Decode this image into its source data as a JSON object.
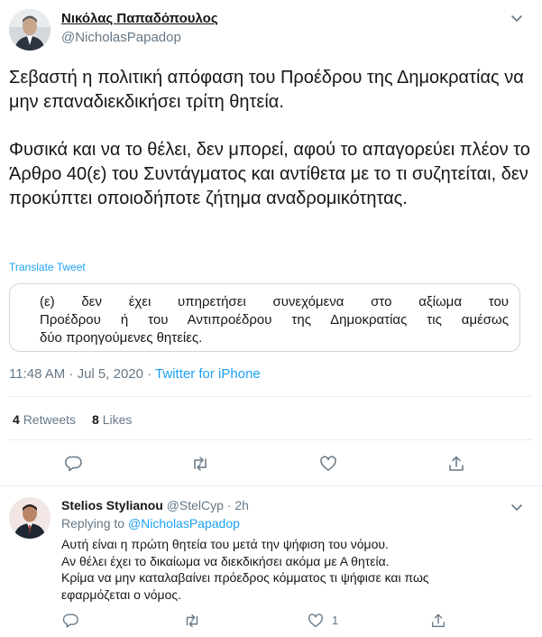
{
  "tweet": {
    "author_name": "Νικόλας Παπαδόπουλος",
    "author_handle": "@NicholasPapadop",
    "paragraph1": "Σεβαστή η πολιτική απόφαση του Προέδρου της Δημοκρατίας να μην επαναδιεκδικήσει τρίτη θητεία.",
    "paragraph2": "Φυσικά και να το θέλει, δεν μπορεί, αφού το απαγορεύει πλέον το Άρθρο 40(ε) του Συντάγματος και αντίθετα με το τι συζητείται, δεν προκύπτει οποιοδήποτε ζήτημα αναδρομικότητας.",
    "translate_label": "Translate Tweet",
    "quote_lines": [
      "(ε) δεν έχει υπηρετήσει συνεχόμενα στο αξίωμα του",
      "Προέδρου ή του Αντιπροέδρου της Δημοκρατίας τις αμέσως",
      "δύο προηγούμενες θητείες."
    ],
    "timestamp": "11:48 AM · Jul 5, 2020 · ",
    "source": "Twitter for iPhone",
    "retweets_count": "4",
    "retweets_label": "Retweets",
    "likes_count": "8",
    "likes_label": "Likes"
  },
  "reply": {
    "author_name": "Stelios Stylianou",
    "author_handle": "@StelCyp",
    "time": " · 2h",
    "replying_prefix": "Replying to ",
    "replying_to": "@NicholasPapadop",
    "lines": [
      "Αυτή είναι η πρώτη θητεία του μετά την ψήφιση του νόμου.",
      "Αν θέλει έχει το δικαίωμα να διεκδικήσει ακόμα με Α θητεία.",
      "Κρίμα να μην καταλαβαίνει πρόεδρος κόμματος τι ψήφισε και πως",
      "εφαρμόζεται ο νόμος."
    ],
    "like_count": "1"
  },
  "icons": {
    "reply": "comment-icon",
    "retweet": "retweet-icon",
    "like": "heart-icon",
    "share": "share-icon",
    "more": "chevron-down-icon"
  },
  "colors": {
    "accent": "#1da1f2",
    "muted": "#657786",
    "text": "#14171a",
    "border": "#e6ecf0"
  }
}
